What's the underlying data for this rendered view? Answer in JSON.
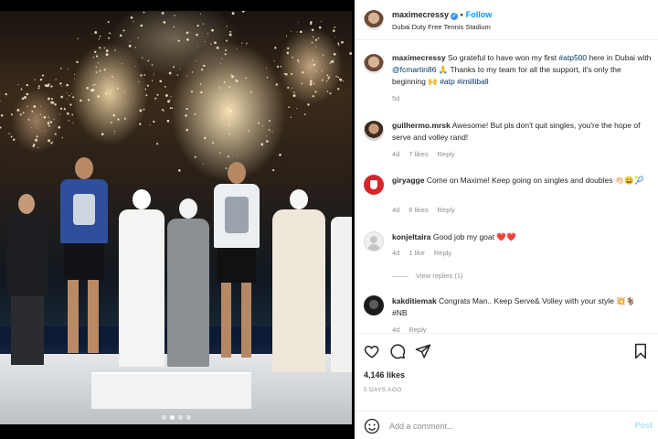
{
  "post": {
    "author": "maximecressy",
    "follow_label": "Follow",
    "location": "Dubai Duty Free Tennis Stadium",
    "caption": {
      "username": "maximecressy",
      "text_before": "So grateful to have won my first ",
      "tag1": "#atp500",
      "text_mid": " here in Dubai with ",
      "mention": "@fcmartin86",
      "text_after": " 🙏 Thanks to my team for all the support, it's only the beginning 🙌 ",
      "tag2": "#atp",
      "tag3": "#imilliball",
      "time": "5d"
    },
    "likes": "4,146 likes",
    "date": "5 DAYS AGO"
  },
  "comments": [
    {
      "username": "guilhermo.mrsk",
      "text": "Awesome! But pls don't quit singles, you're the hope of serve and volley rand!",
      "time": "4d",
      "likes": "7 likes",
      "reply": "Reply"
    },
    {
      "username": "giryagge",
      "text": "Come on Maxime! Keep going on singles and doubles 👏🏻😄🎾",
      "time": "4d",
      "likes": "6 likes",
      "reply": "Reply"
    },
    {
      "username": "konjeltaira",
      "text": "Good job my goat ❤️❤️",
      "time": "4d",
      "likes": "1 like",
      "reply": "Reply",
      "view_replies": "View replies (1)"
    },
    {
      "username": "kakditiemak",
      "text": "Congrats Man.. Keep Serve& Volley with your style 💥🐐 #NB",
      "time": "4d",
      "likes": "",
      "reply": "Reply"
    }
  ],
  "actions": {
    "icons": [
      "heart-icon",
      "comment-icon",
      "share-icon",
      "bookmark-icon"
    ],
    "add_comment_placeholder": "Add a comment...",
    "post_label": "Post"
  },
  "carousel": {
    "count": 4,
    "active": 1
  },
  "colors": {
    "link": "#00376b",
    "follow": "#0095f6",
    "verified": "#3897f0",
    "meta": "#8e8e8e"
  }
}
